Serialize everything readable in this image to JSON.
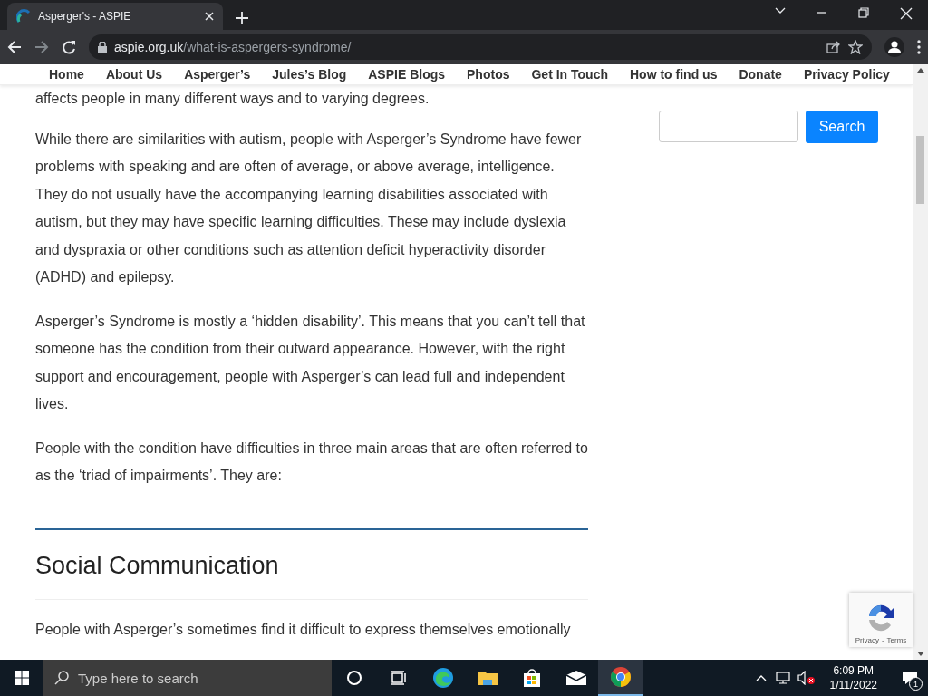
{
  "browser": {
    "tab": {
      "title": "Asperger's - ASPIE",
      "selected": true
    },
    "url_host": "aspie.org.uk",
    "url_path": "/what-is-aspergers-syndrome/"
  },
  "nav": [
    "Home",
    "About Us",
    "Asperger’s",
    "Jules’s Blog",
    "ASPIE Blogs",
    "Photos",
    "Get In Touch",
    "How to find us",
    "Donate",
    "Privacy Policy"
  ],
  "article": {
    "paragraphs": [
      "affects people in many different ways and to varying degrees.",
      "While there are similarities with autism, people with Asperger’s Syndrome have fewer problems with speaking and are often of average, or above average, intelligence. They do not usually have the accompanying learning disabilities associated with autism, but they may have specific learning difficulties. These may include dyslexia and dyspraxia or other conditions such as attention deficit hyperactivity disorder (ADHD) and epilepsy.",
      "Asperger’s Syndrome is mostly a ‘hidden disability’. This means that you can’t tell that someone has the condition from their outward appearance. However, with the right support and encouragement, people with Asperger’s can lead full and independent lives.",
      "People with the condition have difficulties in three main areas that are often referred to as the ‘triad of impairments’. They are:"
    ],
    "heading": "Social Communication",
    "after_heading": "People with Asperger’s sometimes find it difficult to express themselves emotionally"
  },
  "sidebar": {
    "search_button": "Search"
  },
  "recaptcha": {
    "privacy": "Privacy",
    "separator": "-",
    "terms": "Terms"
  },
  "taskbar": {
    "search_placeholder": "Type here to search",
    "apps": [
      {
        "kind": "cortana",
        "active": false
      },
      {
        "kind": "taskview",
        "active": false
      },
      {
        "kind": "edge",
        "active": false
      },
      {
        "kind": "explorer",
        "active": false
      },
      {
        "kind": "store",
        "active": false
      },
      {
        "kind": "mail",
        "active": false
      },
      {
        "kind": "chrome",
        "active": true
      }
    ],
    "time": "6:09 PM",
    "date": "1/11/2022",
    "notifications": "1"
  }
}
